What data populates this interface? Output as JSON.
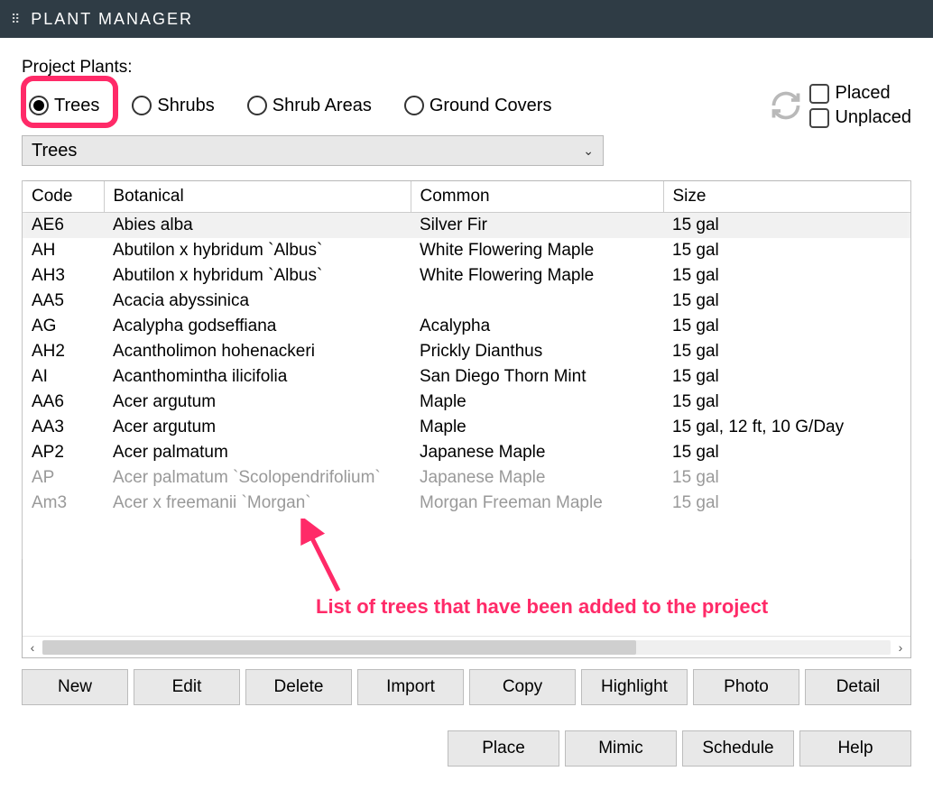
{
  "window": {
    "title": "PLANT MANAGER"
  },
  "section_label": "Project Plants:",
  "radios": {
    "trees": "Trees",
    "shrubs": "Shrubs",
    "shrub_areas": "Shrub Areas",
    "ground_covers": "Ground Covers"
  },
  "checks": {
    "placed": "Placed",
    "unplaced": "Unplaced"
  },
  "dropdown": {
    "selected": "Trees"
  },
  "columns": {
    "code": "Code",
    "botanical": "Botanical",
    "common": "Common",
    "size": "Size"
  },
  "rows": [
    {
      "code": "AE6",
      "botanical": "Abies alba",
      "common": "Silver Fir",
      "size": "15 gal",
      "alt": true
    },
    {
      "code": "AH",
      "botanical": "Abutilon x hybridum `Albus`",
      "common": "White Flowering Maple",
      "size": "15 gal"
    },
    {
      "code": "AH3",
      "botanical": "Abutilon x hybridum `Albus`",
      "common": "White Flowering Maple",
      "size": "15 gal"
    },
    {
      "code": "AA5",
      "botanical": "Acacia abyssinica",
      "common": "",
      "size": "15 gal"
    },
    {
      "code": "AG",
      "botanical": "Acalypha godseffiana",
      "common": "Acalypha",
      "size": "15 gal"
    },
    {
      "code": "AH2",
      "botanical": "Acantholimon hohenackeri",
      "common": "Prickly Dianthus",
      "size": "15 gal"
    },
    {
      "code": "AI",
      "botanical": "Acanthomintha ilicifolia",
      "common": "San Diego Thorn Mint",
      "size": "15 gal"
    },
    {
      "code": "AA6",
      "botanical": "Acer argutum",
      "common": "Maple",
      "size": "15 gal"
    },
    {
      "code": "AA3",
      "botanical": "Acer argutum",
      "common": "Maple",
      "size": "15 gal, 12 ft, 10 G/Day"
    },
    {
      "code": "AP2",
      "botanical": "Acer palmatum",
      "common": "Japanese Maple",
      "size": "15 gal"
    },
    {
      "code": "AP",
      "botanical": "Acer palmatum  `Scolopendrifolium`",
      "common": "Japanese Maple",
      "size": "15 gal",
      "faded": true
    },
    {
      "code": "Am3",
      "botanical": "Acer x freemanii `Morgan`",
      "common": "Morgan Freeman Maple",
      "size": "15 gal",
      "faded": true
    }
  ],
  "annotation": "List of trees that have been added to the project",
  "buttons_main": {
    "new": "New",
    "edit": "Edit",
    "delete": "Delete",
    "import": "Import",
    "copy": "Copy",
    "highlight": "Highlight",
    "photo": "Photo",
    "detail": "Detail"
  },
  "buttons_bottom": {
    "place": "Place",
    "mimic": "Mimic",
    "schedule": "Schedule",
    "help": "Help"
  }
}
